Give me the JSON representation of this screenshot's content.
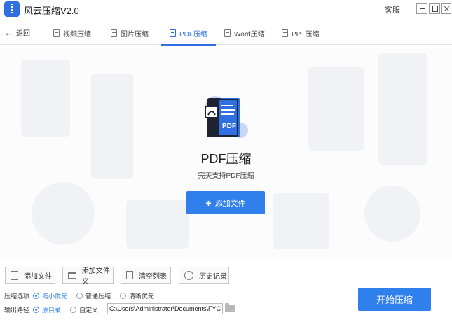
{
  "window": {
    "title": "风云压缩V2.0",
    "service_label": "客服"
  },
  "nav": {
    "back_label": "返回",
    "tabs": [
      {
        "label": "视频压缩",
        "icon": "video-file-icon",
        "active": false
      },
      {
        "label": "图片压缩",
        "icon": "image-file-icon",
        "active": false
      },
      {
        "label": "PDF压缩",
        "icon": "pdf-file-icon",
        "active": true
      },
      {
        "label": "Word压缩",
        "icon": "word-file-icon",
        "active": false
      },
      {
        "label": "PPT压缩",
        "icon": "ppt-file-icon",
        "active": false
      }
    ]
  },
  "main": {
    "title": "PDF压缩",
    "subtitle": "完美支持PDF压缩",
    "add_file_button": "添加文件",
    "illustration_label": "PDF"
  },
  "toolbar": {
    "buttons": [
      {
        "label": "添加文件",
        "icon": "add-file-icon"
      },
      {
        "label": "添加文件夹",
        "icon": "add-folder-icon"
      },
      {
        "label": "清空列表",
        "icon": "trash-icon"
      },
      {
        "label": "历史记录",
        "icon": "clock-icon"
      }
    ]
  },
  "options": {
    "compress_label": "压缩选项:",
    "compress_choices": [
      {
        "label": "缩小优先",
        "selected": true
      },
      {
        "label": "普通压缩",
        "selected": false
      },
      {
        "label": "清晰优先",
        "selected": false
      }
    ],
    "output_label": "输出路径:",
    "output_choices": [
      {
        "label": "原目录",
        "selected": true
      },
      {
        "label": "自定义",
        "selected": false
      }
    ],
    "output_path": "C:\\Users\\Administrator\\Documents\\FYCom"
  },
  "start_button": "开始压缩",
  "colors": {
    "accent": "#2f80ed",
    "brand": "#2f6fe0"
  }
}
